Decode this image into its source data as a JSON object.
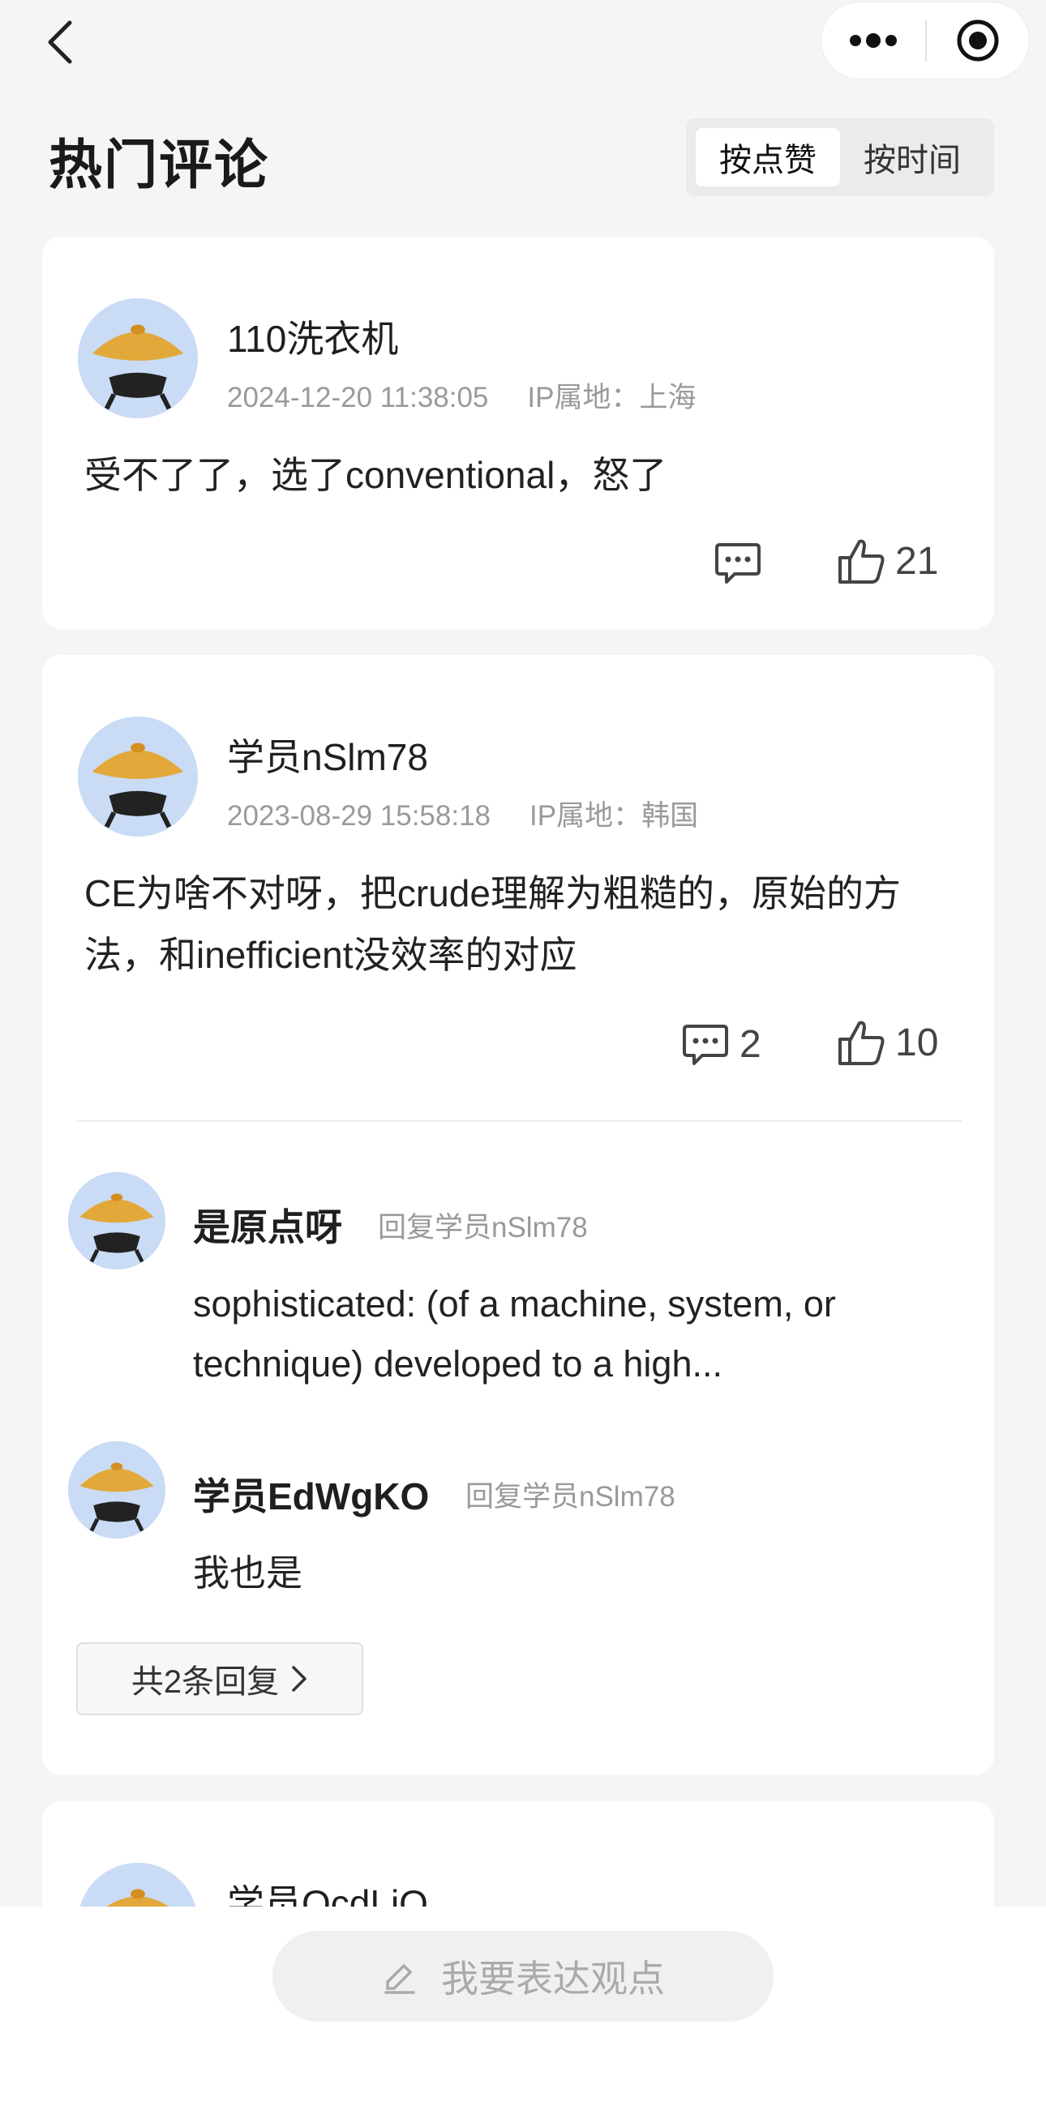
{
  "header": {
    "title": "热门评论",
    "sort_options": [
      "按点赞",
      "按时间"
    ],
    "active_sort": "按点赞"
  },
  "icons": {
    "back": "chevron-left-icon",
    "more": "more-dots-icon",
    "capsule_close": "target-circle-icon",
    "reply": "comment-bubble-icon",
    "like": "thumbs-up-icon",
    "compose": "pencil-icon"
  },
  "comments": [
    {
      "username": "110洗衣机",
      "time": "2024-12-20 11:38:05",
      "ip": "IP属地：上海",
      "text": "受不了了，选了conventional，怒了",
      "reply_count": "",
      "likes": "21"
    },
    {
      "username": "学员nSlm78",
      "time": "2023-08-29 15:58:18",
      "ip": "IP属地：韩国",
      "text": "CE为啥不对呀，把crude理解为粗糙的，原始的方法，和inefficient没效率的对应",
      "reply_count": "2",
      "likes": "10",
      "replies": [
        {
          "username": "是原点呀",
          "reply_to": "回复学员nSlm78",
          "text": "sophisticated: (of a machine, system, or technique) developed to a high..."
        },
        {
          "username": "学员EdWgKO",
          "reply_to": "回复学员nSlm78",
          "text": "我也是"
        }
      ],
      "more_replies": "共2条回复"
    },
    {
      "username": "学员QcdLiQ"
    }
  ],
  "footer": {
    "compose_placeholder": "我要表达观点"
  },
  "colors": {
    "background": "#f5f5f5",
    "card": "#ffffff",
    "avatar_bg": "#c9dbf5",
    "hat": "#e2a93a",
    "muted_text": "#9a9a9a"
  }
}
